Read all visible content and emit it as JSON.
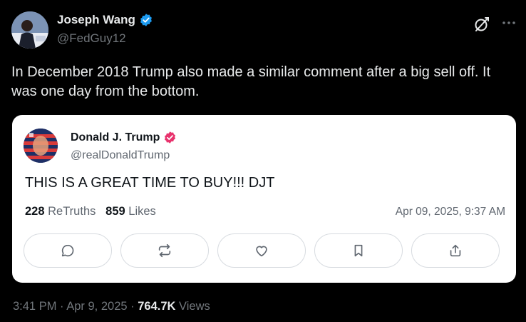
{
  "tweet": {
    "author_name": "Joseph Wang",
    "author_handle": "@FedGuy12",
    "text": "In December 2018 Trump also made a similar comment after a big sell off. It was one day from the bottom.",
    "time": "3:41 PM",
    "date": "Apr 9, 2025",
    "views_count": "764.7K",
    "views_label": "Views",
    "separator": "·"
  },
  "quoted": {
    "author_name": "Donald J. Trump",
    "author_handle": "@realDonaldTrump",
    "text": "THIS IS A GREAT TIME TO BUY!!! DJT",
    "retruths_count": "228",
    "retruths_label": "ReTruths",
    "likes_count": "859",
    "likes_label": "Likes",
    "timestamp": "Apr 09, 2025, 9:37 AM"
  },
  "colors": {
    "background": "#000000",
    "verified_blue": "#1d9bf0",
    "verified_pink": "#e8336d",
    "card_background": "#ffffff"
  },
  "icons": [
    "verified-badge-icon",
    "grok-icon",
    "more-icon",
    "reply-icon",
    "retruth-icon",
    "like-icon",
    "bookmark-icon",
    "share-icon"
  ]
}
